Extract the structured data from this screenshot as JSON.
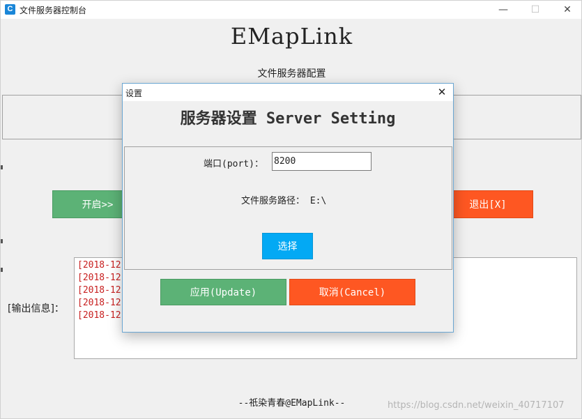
{
  "window": {
    "title": "文件服务器控制台",
    "icon_letter": "C",
    "controls": {
      "minimize": "—",
      "maximize": "☐",
      "close": "✕"
    }
  },
  "header": {
    "brand": "EMapLink",
    "subtitle": "文件服务器配置"
  },
  "buttons": {
    "start": "开启>>",
    "exit": "退出[X]"
  },
  "output": {
    "label": "[输出信息]：",
    "lines": [
      "[2018-12-",
      "[2018-12-",
      "[2018-12-",
      "[2018-12-",
      "[2018-12-"
    ]
  },
  "footer": "--祇染青春@EMapLink--",
  "watermark": "https://blog.csdn.net/weixin_40717107",
  "dialog": {
    "title": "设置",
    "close": "✕",
    "heading": "服务器设置 Server Setting",
    "port_label": "端口(port)：",
    "port_value": "8200",
    "path_label": "文件服务路径：",
    "path_value": "E:\\",
    "choose": "选择",
    "apply": "应用(Update)",
    "cancel": "取消(Cancel)"
  },
  "colors": {
    "green": "#5cb276",
    "orange": "#fe5722",
    "blue": "#03a9f4",
    "log_text": "#c82020"
  }
}
